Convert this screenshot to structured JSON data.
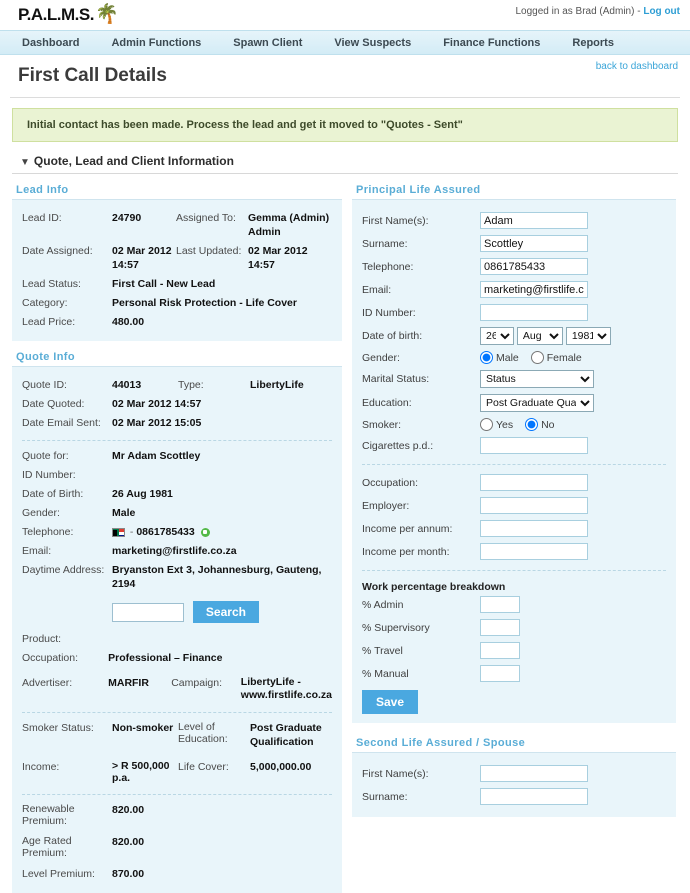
{
  "header": {
    "logo_text": "P.A.L.M.S.",
    "logo_icon": "palm-tree-icon",
    "logged_in_text": "Logged in as Brad (Admin) -",
    "logout_label": "Log out"
  },
  "nav": {
    "items": [
      {
        "label": "Dashboard"
      },
      {
        "label": "Admin Functions"
      },
      {
        "label": "Spawn Client"
      },
      {
        "label": "View Suspects"
      },
      {
        "label": "Finance Functions"
      },
      {
        "label": "Reports"
      }
    ]
  },
  "page": {
    "title": "First Call Details",
    "back_link": "back to dashboard",
    "notice": "Initial contact has been made. Process the lead and get it moved to \"Quotes - Sent\"",
    "section_title": "Quote, Lead and Client Information"
  },
  "lead_info": {
    "panel_title": "Lead Info",
    "rows": [
      {
        "k": "Lead ID:",
        "v": "24790",
        "k2": "Assigned To:",
        "v2": "Gemma (Admin) Admin"
      },
      {
        "k": "Date Assigned:",
        "v": "02 Mar 2012 14:57",
        "k2": "Last Updated:",
        "v2": "02 Mar 2012 14:57"
      },
      {
        "k": "Lead Status:",
        "v": "First Call - New Lead",
        "k2": "",
        "v2": ""
      },
      {
        "k": "Category:",
        "v": "Personal Risk Protection - Life Cover",
        "k2": "",
        "v2": ""
      },
      {
        "k": "Lead Price:",
        "v": "480.00",
        "k2": "",
        "v2": ""
      }
    ]
  },
  "quote_info": {
    "panel_title": "Quote Info",
    "quote_id_label": "Quote ID:",
    "quote_id_value": "44013",
    "type_label": "Type:",
    "type_value": "LibertyLife",
    "date_quoted_label": "Date Quoted:",
    "date_quoted_value": "02 Mar 2012 14:57",
    "date_email_label": "Date Email Sent:",
    "date_email_value": "02 Mar 2012 15:05",
    "quote_for_label": "Quote for:",
    "quote_for_value": "Mr Adam Scottley",
    "id_number_label": "ID Number:",
    "id_number_value": "",
    "dob_label": "Date of Birth:",
    "dob_value": "26 Aug 1981",
    "gender_label": "Gender:",
    "gender_value": "Male",
    "telephone_label": "Telephone:",
    "telephone_dash": "-",
    "telephone_value": "0861785433",
    "email_label": "Email:",
    "email_value": "marketing@firstlife.co.za",
    "address_label": "Daytime Address:",
    "address_value": "Bryanston Ext 3, Johannesburg, Gauteng, 2194",
    "search_input_value": "",
    "search_button": "Search",
    "product_label": "Product:",
    "product_value": "",
    "occupation_label": "Occupation:",
    "occupation_value": "Professional – Finance",
    "advertiser_label": "Advertiser:",
    "advertiser_value": "MARFIR",
    "campaign_label": "Campaign:",
    "campaign_value": "LibertyLife - www.firstlife.co.za",
    "smoker_label": "Smoker Status:",
    "smoker_value": "Non-smoker",
    "education_label": "Level of Education:",
    "education_value": "Post Graduate Qualification",
    "income_label": "Income:",
    "income_value": "> R 500,000 p.a.",
    "life_cover_label": "Life Cover:",
    "life_cover_value": "5,000,000.00",
    "renewable_label": "Renewable Premium:",
    "renewable_value": "820.00",
    "age_rated_label": "Age Rated Premium:",
    "age_rated_value": "820.00",
    "level_premium_label": "Level Premium:",
    "level_premium_value": "870.00"
  },
  "principal": {
    "panel_title": "Principal Life Assured",
    "first_names_label": "First Name(s):",
    "first_names_value": "Adam",
    "surname_label": "Surname:",
    "surname_value": "Scottley",
    "telephone_label": "Telephone:",
    "telephone_value": "0861785433",
    "email_label": "Email:",
    "email_value": "marketing@firstlife.co.za",
    "id_number_label": "ID Number:",
    "id_number_value": "",
    "dob_label": "Date of birth:",
    "dob_day": "26",
    "dob_month": "Aug",
    "dob_year": "1981",
    "gender_label": "Gender:",
    "gender_male": "Male",
    "gender_female": "Female",
    "marital_label": "Marital Status:",
    "marital_value": "Status",
    "education_label": "Education:",
    "education_value": "Post Graduate Qualifi",
    "smoker_label": "Smoker:",
    "smoker_yes": "Yes",
    "smoker_no": "No",
    "cigarettes_label": "Cigarettes p.d.:",
    "cigarettes_value": "",
    "occupation_label": "Occupation:",
    "occupation_value": "",
    "employer_label": "Employer:",
    "employer_value": "",
    "income_annum_label": "Income per annum:",
    "income_annum_value": "",
    "income_month_label": "Income per month:",
    "income_month_value": "",
    "work_breakdown_title": "Work percentage breakdown",
    "pct_admin_label": "% Admin",
    "pct_admin_value": "",
    "pct_supervisory_label": "% Supervisory",
    "pct_supervisory_value": "",
    "pct_travel_label": "% Travel",
    "pct_travel_value": "",
    "pct_manual_label": "% Manual",
    "pct_manual_value": "",
    "save_label": "Save"
  },
  "second_life": {
    "panel_title": "Second Life Assured / Spouse",
    "first_names_label": "First Name(s):",
    "first_names_value": "",
    "surname_label": "Surname:",
    "surname_value": ""
  },
  "colors": {
    "accent_blue": "#4aa8e0",
    "panel_bg": "#e9f5fa",
    "notice_bg": "#eaf3d3",
    "link": "#3aa5d8"
  }
}
